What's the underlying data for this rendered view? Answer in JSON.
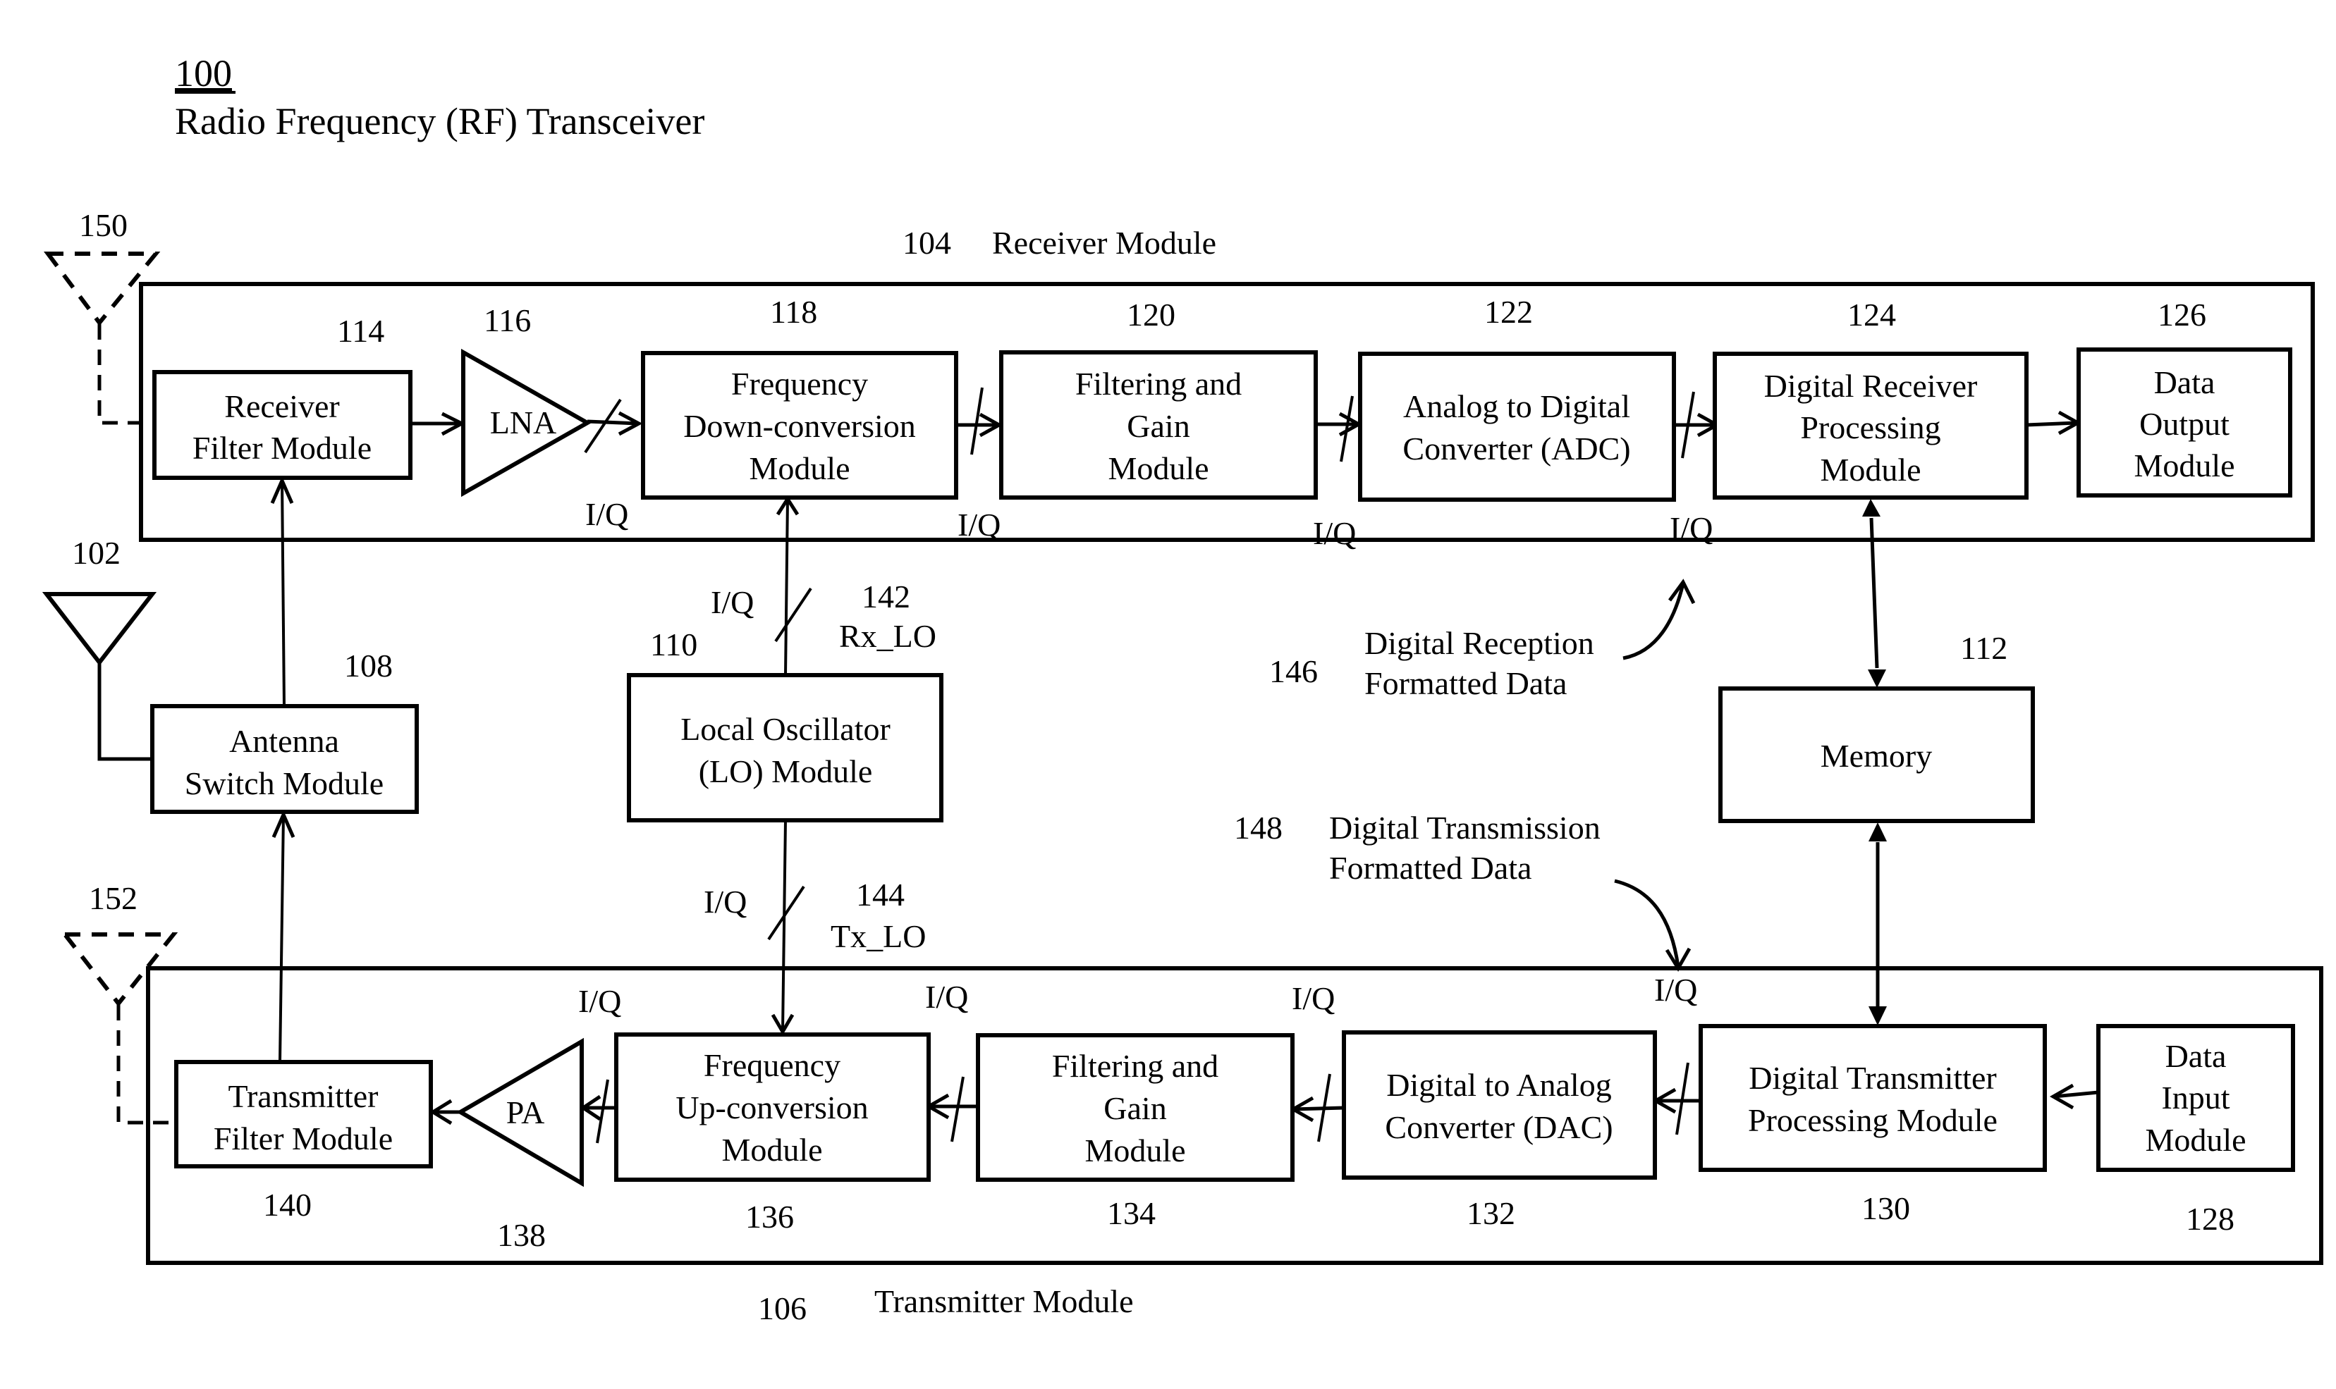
{
  "figure": {
    "number": "100",
    "title": "Radio Frequency (RF) Transceiver"
  },
  "regions": {
    "receiver": {
      "ref": "104",
      "label": "Receiver Module"
    },
    "transmitter": {
      "ref": "106",
      "label": "Transmitter Module"
    }
  },
  "antennas": {
    "main": {
      "ref": "102"
    },
    "rx_optional": {
      "ref": "150"
    },
    "tx_optional": {
      "ref": "152"
    }
  },
  "blocks": {
    "antenna_switch": {
      "ref": "108",
      "lines": [
        "Antenna",
        "Switch Module"
      ]
    },
    "local_oscillator": {
      "ref": "110",
      "lines": [
        "Local Oscillator",
        "(LO) Module"
      ]
    },
    "memory": {
      "ref": "112",
      "lines": [
        "Memory"
      ]
    },
    "rx_filter": {
      "ref": "114",
      "lines": [
        "Receiver",
        "Filter Module"
      ]
    },
    "lna": {
      "ref": "116",
      "lines": [
        "LNA"
      ]
    },
    "freq_down": {
      "ref": "118",
      "lines": [
        "Frequency",
        "Down-conversion",
        "Module"
      ]
    },
    "rx_filt_gain": {
      "ref": "120",
      "lines": [
        "Filtering and",
        "Gain",
        "Module"
      ]
    },
    "adc": {
      "ref": "122",
      "lines": [
        "Analog to Digital",
        "Converter (ADC)"
      ]
    },
    "drx_proc": {
      "ref": "124",
      "lines": [
        "Digital Receiver",
        "Processing",
        "Module"
      ]
    },
    "data_output": {
      "ref": "126",
      "lines": [
        "Data",
        "Output",
        "Module"
      ]
    },
    "data_input": {
      "ref": "128",
      "lines": [
        "Data",
        "Input",
        "Module"
      ]
    },
    "dtx_proc": {
      "ref": "130",
      "lines": [
        "Digital Transmitter",
        "Processing Module"
      ]
    },
    "dac": {
      "ref": "132",
      "lines": [
        "Digital to Analog",
        "Converter (DAC)"
      ]
    },
    "tx_filt_gain": {
      "ref": "134",
      "lines": [
        "Filtering and",
        "Gain",
        "Module"
      ]
    },
    "freq_up": {
      "ref": "136",
      "lines": [
        "Frequency",
        "Up-conversion",
        "Module"
      ]
    },
    "pa": {
      "ref": "138",
      "lines": [
        "PA"
      ]
    },
    "tx_filter": {
      "ref": "140",
      "lines": [
        "Transmitter",
        "Filter Module"
      ]
    }
  },
  "signals": {
    "rx_lo": {
      "ref": "142",
      "label": "Rx_LO",
      "bus": "I/Q"
    },
    "tx_lo": {
      "ref": "144",
      "label": "Tx_LO",
      "bus": "I/Q"
    },
    "digital_reception": {
      "ref": "146",
      "lines": [
        "Digital Reception",
        "Formatted Data"
      ]
    },
    "digital_transmission": {
      "ref": "148",
      "lines": [
        "Digital Transmission",
        "Formatted Data"
      ]
    },
    "bus_label": "I/Q"
  }
}
